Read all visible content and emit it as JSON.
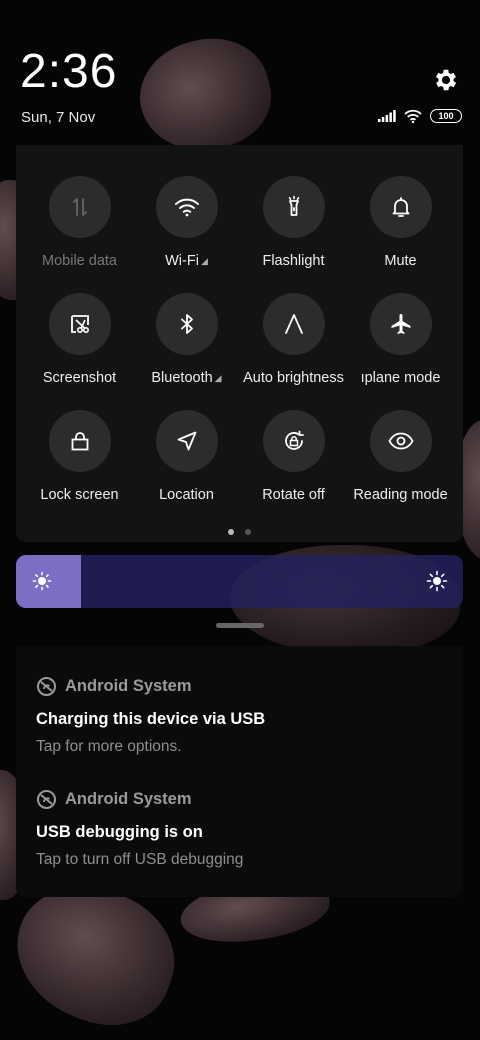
{
  "status": {
    "time": "2:36",
    "date": "Sun, 7 Nov",
    "battery": "100"
  },
  "quick_settings": {
    "tiles": [
      {
        "label": "Mobile data",
        "icon": "mobile-data-icon",
        "enabled": false
      },
      {
        "label": "Wi-Fi",
        "icon": "wifi-icon",
        "enabled": true,
        "expandable": true
      },
      {
        "label": "Flashlight",
        "icon": "flashlight-icon",
        "enabled": true
      },
      {
        "label": "Mute",
        "icon": "bell-icon",
        "enabled": true
      },
      {
        "label": "Screenshot",
        "icon": "screenshot-icon",
        "enabled": true
      },
      {
        "label": "Bluetooth",
        "icon": "bluetooth-icon",
        "enabled": true,
        "expandable": true
      },
      {
        "label": "Auto brightness",
        "icon": "auto-brightness-icon",
        "enabled": true
      },
      {
        "label": "ıplane mode",
        "icon": "airplane-icon",
        "enabled": true
      },
      {
        "label": "Lock screen",
        "icon": "lock-icon",
        "enabled": true
      },
      {
        "label": "Location",
        "icon": "location-icon",
        "enabled": true
      },
      {
        "label": "Rotate off",
        "icon": "rotate-icon",
        "enabled": true
      },
      {
        "label": "Reading mode",
        "icon": "eye-icon",
        "enabled": true
      }
    ],
    "page_count": 2,
    "current_page": 1
  },
  "brightness": {
    "level": 0.145,
    "fill_color": "#7a6fc4"
  },
  "notifications": [
    {
      "app": "Android System",
      "title": "Charging this device via USB",
      "text": "Tap for more options."
    },
    {
      "app": "Android System",
      "title": "USB debugging is on",
      "text": "Tap to turn off USB debugging"
    }
  ]
}
